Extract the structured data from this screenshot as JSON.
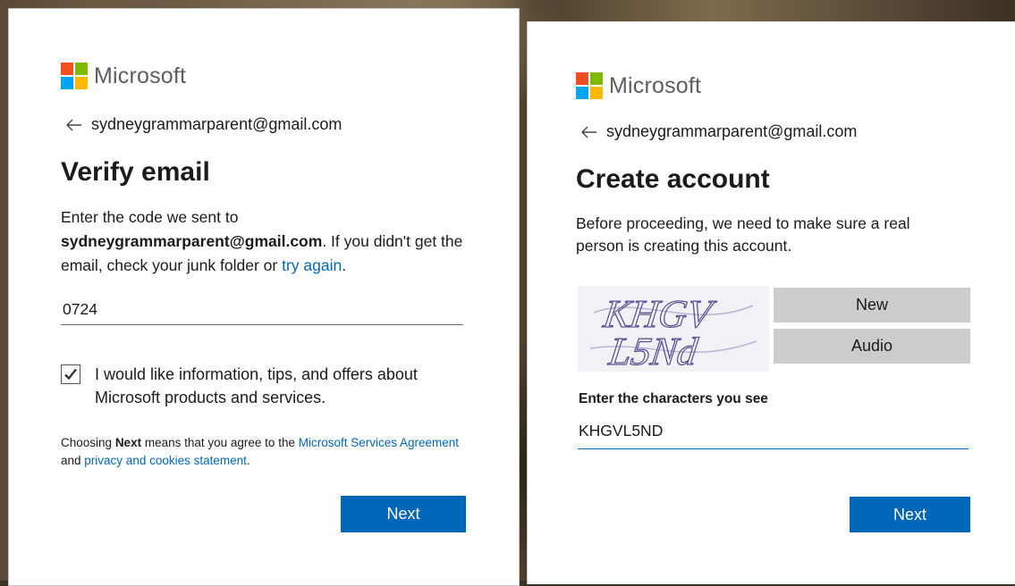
{
  "colors": {
    "brand_red": "#f25022",
    "brand_green": "#7fba00",
    "brand_blue": "#00a4ef",
    "brand_yellow": "#ffb900",
    "primary_button": "#0067b8",
    "link": "#0067b8",
    "secondary_button": "#cccccc"
  },
  "icons": {
    "logo": "microsoft-logo-icon",
    "back": "back-arrow-icon",
    "checkbox": "checkmark-icon"
  },
  "left_panel": {
    "logo_text": "Microsoft",
    "identity_email": "sydneygrammarparent@gmail.com",
    "title": "Verify email",
    "desc_prefix": "Enter the code we sent to",
    "desc_email": "sydneygrammarparent@gmail.com",
    "desc_middle": ". If you didn't get the email, check your junk folder or",
    "desc_link": "try again",
    "desc_suffix": ".",
    "code_value": "0724",
    "marketing_checked": true,
    "marketing_label": "I would like information, tips, and offers about Microsoft products and services.",
    "legal_prefix": "Choosing",
    "legal_bold": "Next",
    "legal_middle": "means that you agree to the",
    "legal_link_services": "Microsoft Services Agreement",
    "legal_and": "and",
    "legal_link_privacy": "privacy and cookies statement",
    "legal_suffix": ".",
    "next_label": "Next"
  },
  "right_panel": {
    "logo_text": "Microsoft",
    "identity_email": "sydneygrammarparent@gmail.com",
    "title": "Create account",
    "description": "Before proceeding, we need to make sure a real person is creating this account.",
    "captcha_line1": "KHGV",
    "captcha_line2": "L5Nd",
    "new_label": "New",
    "audio_label": "Audio",
    "field_label": "Enter the characters you see",
    "chars_value": "KHGVL5ND",
    "next_label": "Next"
  }
}
